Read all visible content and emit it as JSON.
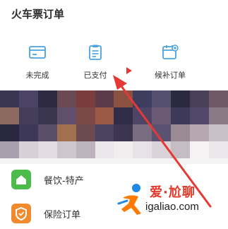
{
  "header": {
    "title": "火车票订单"
  },
  "order_tabs": [
    {
      "label": "未完成",
      "icon": "card-icon"
    },
    {
      "label": "已支付",
      "icon": "clipboard-icon"
    },
    {
      "label": "候补订单",
      "icon": "calendar-add-icon"
    }
  ],
  "services": [
    {
      "label": "餐饮-特产",
      "icon": "home-icon",
      "color": "#4cbb4a"
    },
    {
      "label": "保险订单",
      "icon": "shield-icon",
      "color": "#f08a2c"
    }
  ],
  "watermark": {
    "brand": "爱·尬聊",
    "url": "igaliao.com"
  },
  "colors": {
    "accent": "#4aa3e0",
    "arrow": "#e53935"
  }
}
